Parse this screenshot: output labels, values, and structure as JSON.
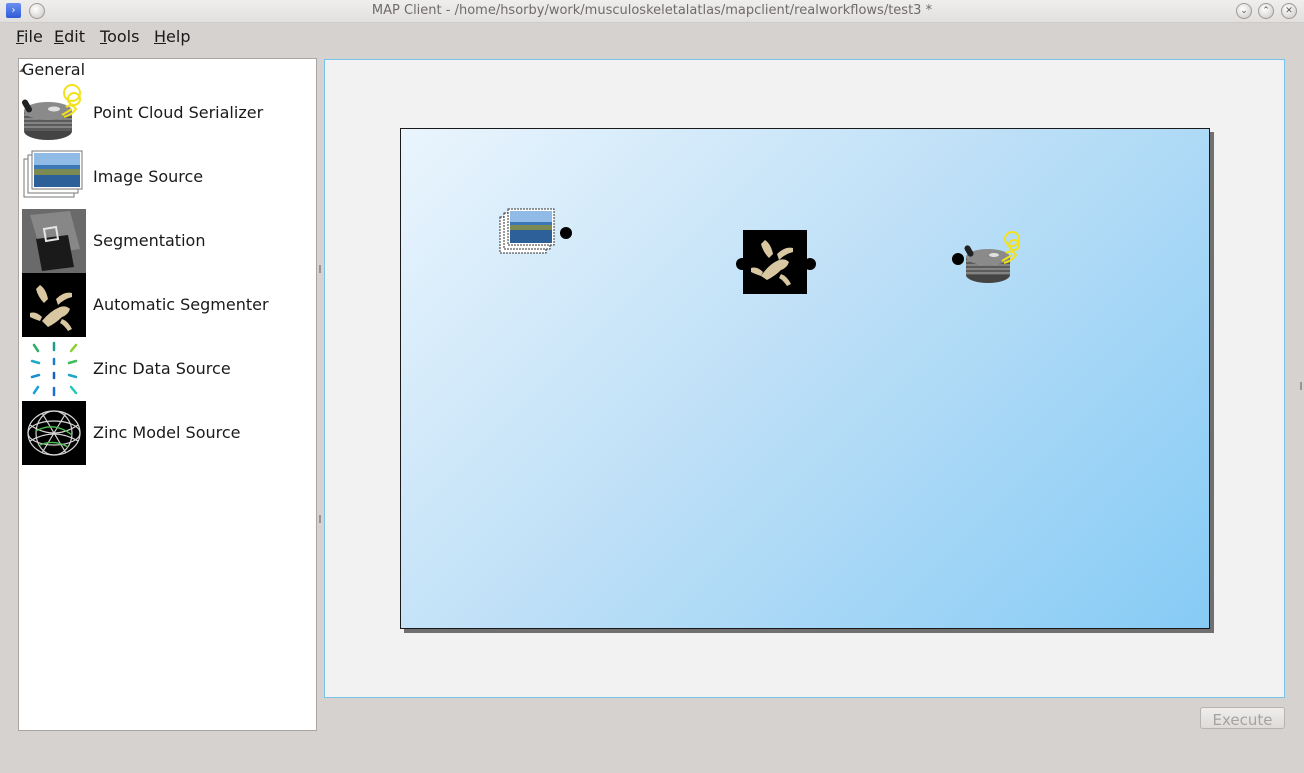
{
  "window": {
    "title": "MAP Client - /home/hsorby/work/musculoskeletalatlas/mapclient/realworkflows/test3 *",
    "menu_icon": "kde-window-menu-icon",
    "pin_icon": "pin-icon",
    "buttons": [
      "minimize-icon",
      "maximize-icon",
      "close-icon"
    ]
  },
  "menubar": {
    "items": [
      {
        "label": "File",
        "mnemonic": "F",
        "rest": "ile"
      },
      {
        "label": "Edit",
        "mnemonic": "E",
        "rest": "dit"
      },
      {
        "label": "Tools",
        "mnemonic": "T",
        "rest": "ools"
      },
      {
        "label": "Help",
        "mnemonic": "H",
        "rest": "elp"
      }
    ]
  },
  "palette": {
    "group": "General",
    "steps": [
      {
        "label": "Point Cloud Serializer",
        "icon": "hard-drive-icon"
      },
      {
        "label": "Image Source",
        "icon": "image-stack-icon"
      },
      {
        "label": "Segmentation",
        "icon": "segmentation-icon"
      },
      {
        "label": "Automatic Segmenter",
        "icon": "bone-icon"
      },
      {
        "label": "Zinc Data Source",
        "icon": "vector-field-icon"
      },
      {
        "label": "Zinc Model Source",
        "icon": "mesh-icon"
      }
    ]
  },
  "workflow": {
    "nodes": [
      {
        "name": "Image Source",
        "icon": "image-stack-icon"
      },
      {
        "name": "Automatic Segmenter",
        "icon": "bone-icon"
      },
      {
        "name": "Point Cloud Serializer",
        "icon": "hard-drive-icon"
      }
    ]
  },
  "actions": {
    "execute_label": "Execute",
    "execute_enabled": false
  },
  "colors": {
    "window_bg": "#d6d2d0",
    "canvas_gradient_start": "#eaf5fd",
    "canvas_gradient_end": "#86cbf5",
    "focus_border": "#79c3ea"
  }
}
